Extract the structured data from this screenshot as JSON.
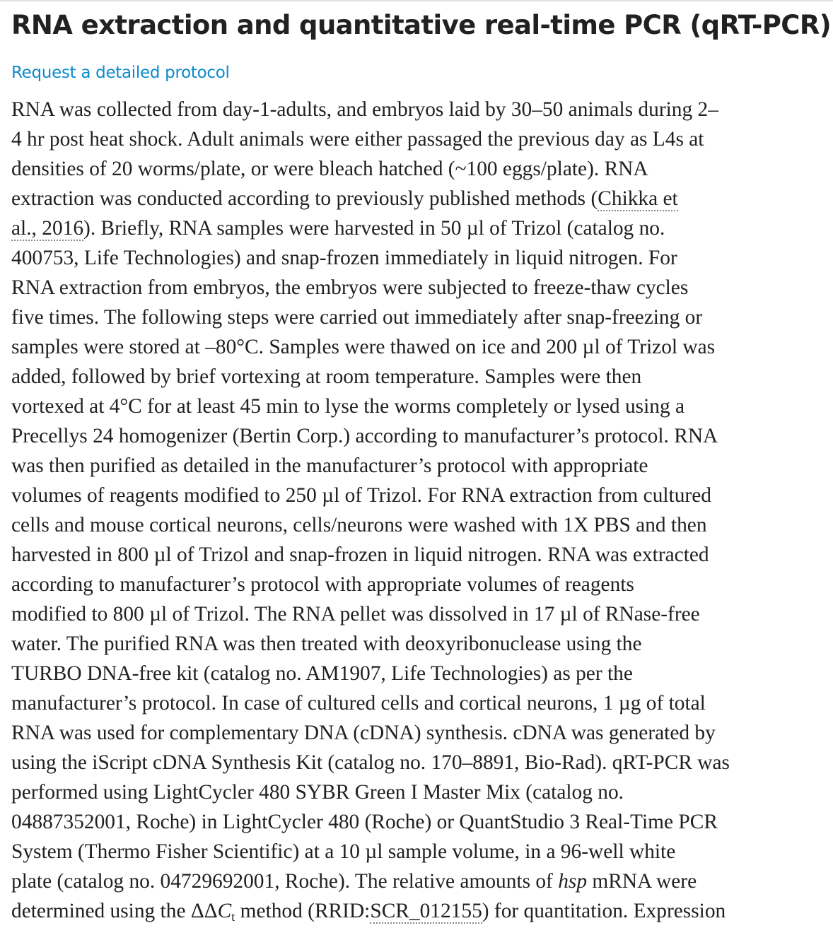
{
  "title": "RNA extraction and quantitative real-time PCR (qRT-PCR)",
  "protocol_link": "Request a detailed protocol",
  "paragraph": {
    "l1": "RNA was collected from day-1-adults, and embryos laid by 30–50 animals during 2–",
    "l2": "4 hr post heat shock. Adult animals were either passaged the previous day as L4s at",
    "l3": "densities of 20 worms/plate, or were bleach hatched (~100 eggs/plate). RNA",
    "l4_pre": "extraction was conducted according to previously published methods (",
    "l4_cite": "Chikka et",
    "l5_cite": "al., 2016",
    "l5_post": "). Briefly, RNA samples were harvested in 50 µl of Trizol (catalog no.",
    "l6": "400753, Life Technologies) and snap-frozen immediately in liquid nitrogen. For",
    "l7": "RNA extraction from embryos, the embryos were subjected to freeze-thaw cycles",
    "l8": "five times. The following steps were carried out immediately after snap-freezing or",
    "l9": "samples were stored at –80°C. Samples were thawed on ice and 200 µl of Trizol was",
    "l10": "added, followed by brief vortexing at room temperature. Samples were then",
    "l11": "vortexed at 4°C for at least 45 min to lyse the worms completely or lysed using a",
    "l12": "Precellys 24 homogenizer (Bertin Corp.) according to manufacturer’s protocol. RNA",
    "l13": "was then purified as detailed in the manufacturer’s protocol with appropriate",
    "l14": "volumes of reagents modified to 250 µl of Trizol. For RNA extraction from cultured",
    "l15": "cells and mouse cortical neurons, cells/neurons were washed with 1X PBS and then",
    "l16": "harvested in 800 µl of Trizol and snap-frozen in liquid nitrogen. RNA was extracted",
    "l17": "according to manufacturer’s protocol with appropriate volumes of reagents",
    "l18": "modified to 800 µl of Trizol. The RNA pellet was dissolved in 17 µl of RNase-free",
    "l19": "water. The purified RNA was then treated with deoxyribonuclease using the",
    "l20": "TURBO DNA-free kit (catalog no. AM1907, Life Technologies) as per the",
    "l21": "manufacturer’s protocol. In case of cultured cells and cortical neurons, 1 µg of total",
    "l22": "RNA was used for complementary DNA (cDNA) synthesis. cDNA was generated by",
    "l23": "using the iScript cDNA Synthesis Kit (catalog no. 170–8891, Bio-Rad). qRT-PCR was",
    "l24": "performed using LightCycler 480 SYBR Green I Master Mix (catalog no.",
    "l25": "04887352001, Roche) in LightCycler 480 (Roche) or QuantStudio 3 Real-Time PCR",
    "l26": "System (Thermo Fisher Scientific) at a 10 µl sample volume, in a 96-well white",
    "l27_pre": "plate (catalog no. 04729692001, Roche). The relative amounts of ",
    "l27_gene": "hsp",
    "l27_post": " mRNA were",
    "l28_pre": "determined using the ΔΔ",
    "l28_c": "C",
    "l28_t": "t",
    "l28_mid": " method (RRID:",
    "l28_rrid": "SCR_012155",
    "l28_post": ") for quantitation. Expression"
  }
}
